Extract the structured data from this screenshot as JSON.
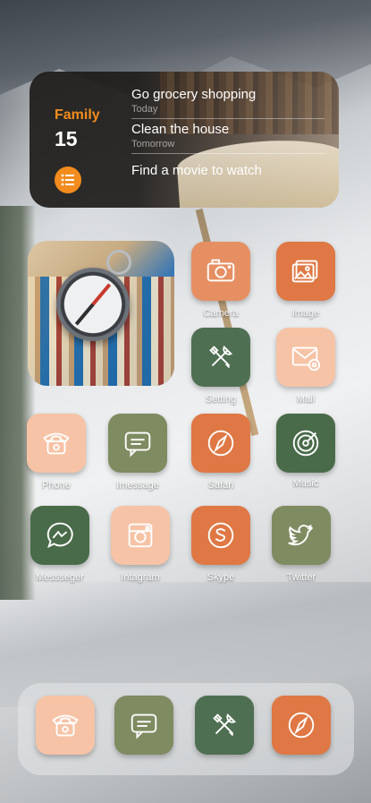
{
  "widget": {
    "list_name": "Family",
    "count": "15",
    "items": [
      {
        "title": "Go grocery shopping",
        "sub": "Today"
      },
      {
        "title": "Clean the house",
        "sub": "Tomorrow"
      },
      {
        "title": "Find a movie to watch",
        "sub": ""
      }
    ]
  },
  "apps": {
    "camera": "Camera",
    "image": "Image",
    "setting": "Setting",
    "mail": "Mail",
    "phone": "Phone",
    "imessage": "Imessage",
    "safari": "Safari",
    "music": "Music",
    "messenger": "Messseger",
    "instagram": "Intagram",
    "skype": "Skype",
    "twitter": "Twitter"
  },
  "colors": {
    "peach": "#f6c3a6",
    "orange": "#e07a45",
    "sage": "#7f8b61",
    "dark_green": "#4a6b4a",
    "accent": "#f28c1e"
  },
  "icons": [
    "camera-icon",
    "image-icon",
    "tools-icon",
    "mail-icon",
    "phone-icon",
    "chat-icon",
    "compass-icon",
    "music-icon",
    "messenger-icon",
    "instagram-icon",
    "skype-icon",
    "twitter-icon"
  ]
}
